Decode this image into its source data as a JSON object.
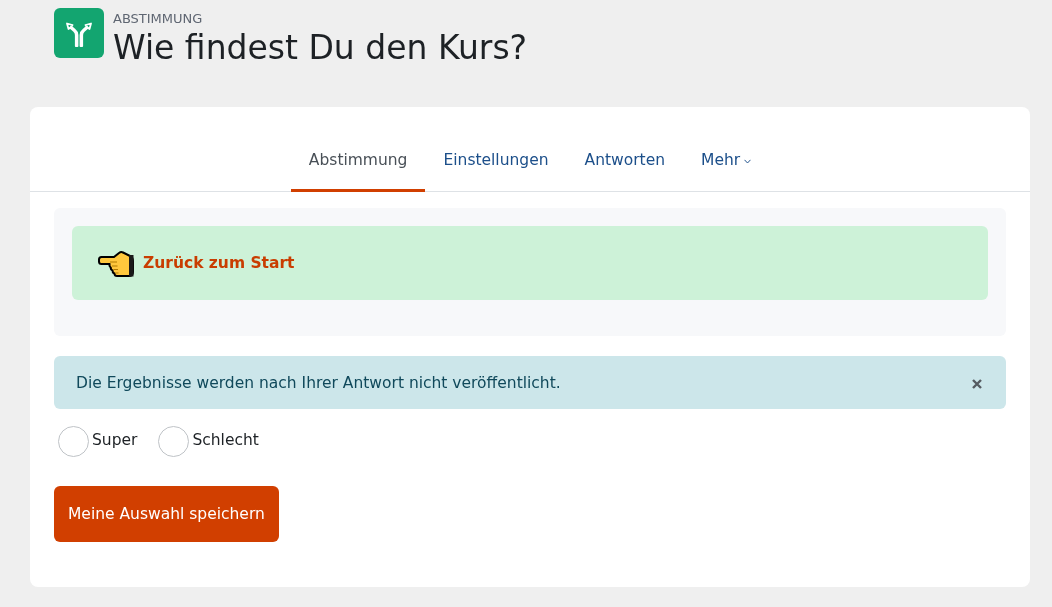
{
  "header": {
    "module": "ABSTIMMUNG",
    "title": "Wie findest Du den Kurs?"
  },
  "tabs": [
    {
      "label": "Abstimmung",
      "selected": true,
      "kind": "link"
    },
    {
      "label": "Einstellungen",
      "selected": false,
      "kind": "link"
    },
    {
      "label": "Antworten",
      "selected": false,
      "kind": "link"
    },
    {
      "label": "Mehr",
      "selected": false,
      "kind": "dropdown"
    }
  ],
  "intro": {
    "link": "Zurück zum Start"
  },
  "alert": {
    "text": "Die Ergebnisse werden nach Ihrer Antwort nicht veröffentlicht.",
    "dismissible": true
  },
  "options": [
    {
      "label": "Super",
      "selected": false
    },
    {
      "label": "Schlecht",
      "selected": false
    }
  ],
  "submit": {
    "label": "Meine Auswahl speichern"
  }
}
